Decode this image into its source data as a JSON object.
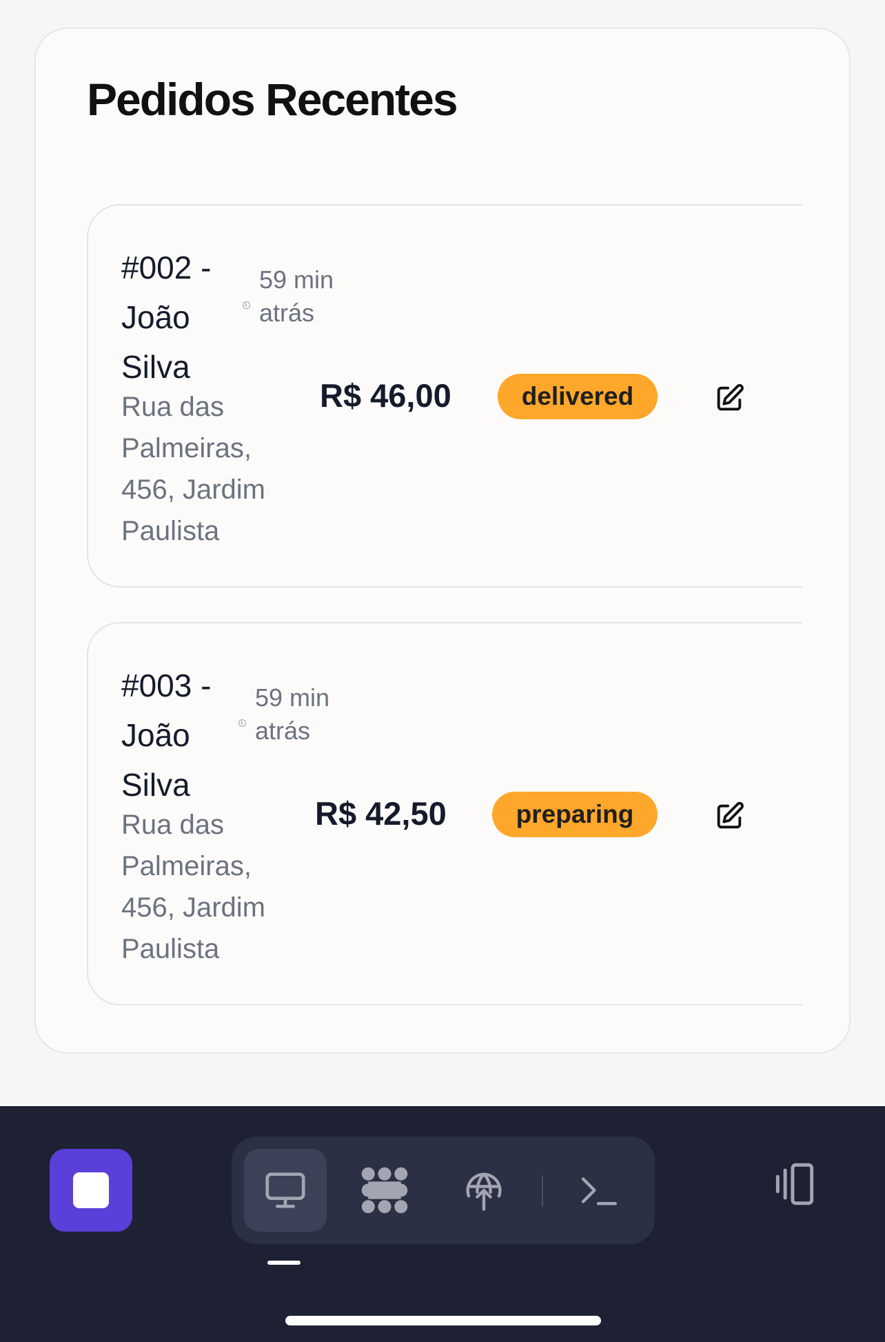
{
  "panel": {
    "title": "Pedidos Recentes"
  },
  "orders": [
    {
      "title": "#002 - João Silva",
      "time": "59 min atrás",
      "address": "Rua das Palmeiras, 456, Jardim Paulista",
      "price": "R$ 46,00",
      "status": "delivered",
      "status_color": "#ffa72a"
    },
    {
      "title": "#003 - João Silva",
      "time": "59 min atrás",
      "address": "Rua das Palmeiras, 456, Jardim Paulista",
      "price": "R$ 42,50",
      "status": "preparing",
      "status_color": "#ffa72a"
    }
  ],
  "icons": {
    "clock": "clock-icon",
    "edit": "edit-icon"
  },
  "dock": {
    "app_button": "app-square-icon",
    "tools": [
      "monitor-icon",
      "nodes-icon",
      "globe-upload-icon",
      "terminal-icon"
    ],
    "active_tool": "monitor-icon",
    "side_button": "side-panel-icon"
  },
  "colors": {
    "accent": "#5a3fd8",
    "badge": "#ffa72a",
    "dock_bg": "#1d2133"
  }
}
